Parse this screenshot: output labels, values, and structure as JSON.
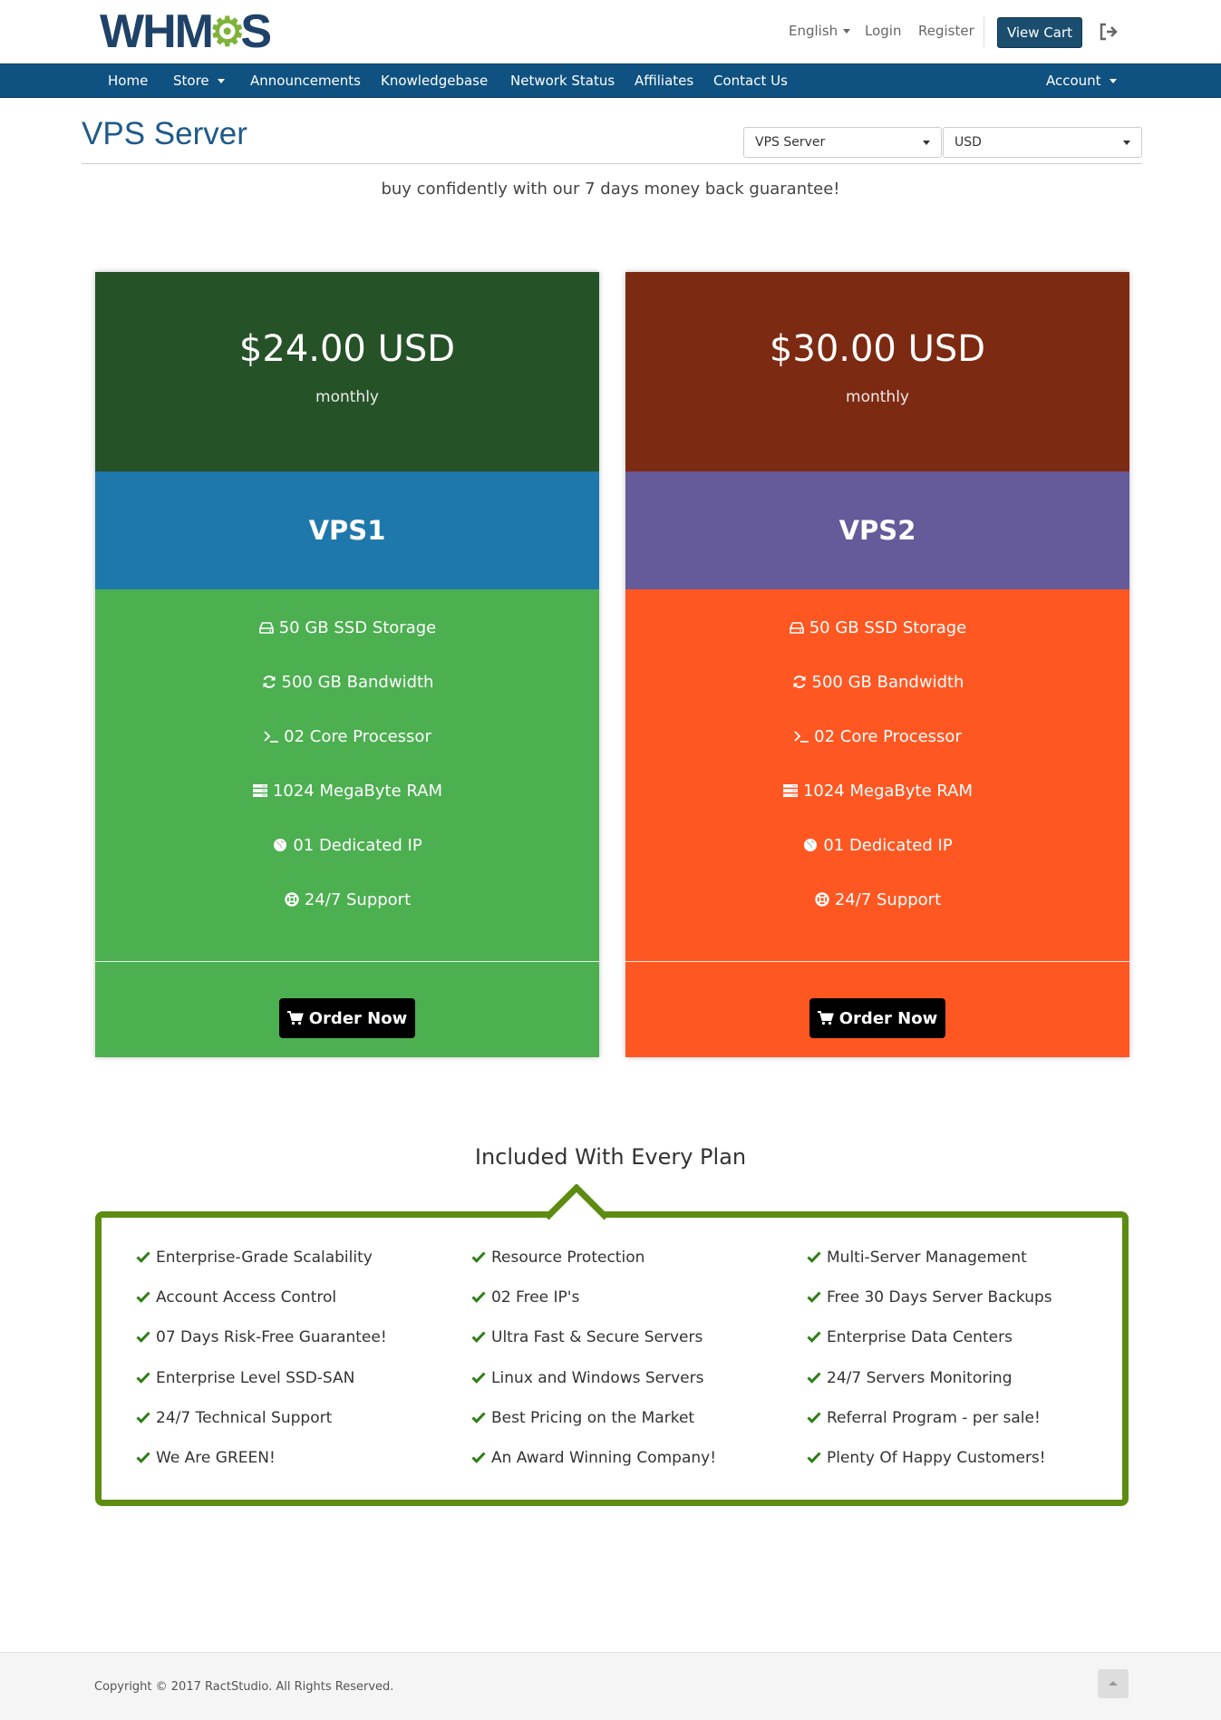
{
  "brand": {
    "logo_text_a": "WHM",
    "logo_text_b": "S"
  },
  "topbar": {
    "language": "English",
    "login": "Login",
    "register": "Register",
    "view_cart": "View Cart"
  },
  "nav": {
    "items": [
      "Home",
      "Store",
      "Announcements",
      "Knowledgebase",
      "Network Status",
      "Affiliates",
      "Contact Us"
    ],
    "account": "Account"
  },
  "page": {
    "title": "VPS Server",
    "product_group_select": "VPS Server",
    "currency_select": "USD",
    "tagline": "buy confidently with our 7 days money back guarantee!"
  },
  "plans": [
    {
      "price": "$24.00 USD",
      "cycle": "monthly",
      "name": "VPS1",
      "colors": {
        "head": "#265228",
        "name": "#1f78ab",
        "body": "#4caf50"
      },
      "features": [
        "50 GB SSD Storage",
        "500 GB Bandwidth",
        "02 Core Processor",
        "1024 MegaByte RAM",
        "01 Dedicated IP",
        "24/7 Support"
      ],
      "feature_icons": [
        "hdd-icon",
        "refresh-icon",
        "terminal-icon",
        "server-icon",
        "globe-icon",
        "support-icon"
      ],
      "order_label": "Order Now"
    },
    {
      "price": "$30.00 USD",
      "cycle": "monthly",
      "name": "VPS2",
      "colors": {
        "head": "#7d2a12",
        "name": "#655a9a",
        "body": "#ff5722"
      },
      "features": [
        "50 GB SSD Storage",
        "500 GB Bandwidth",
        "02 Core Processor",
        "1024 MegaByte RAM",
        "01 Dedicated IP",
        "24/7 Support"
      ],
      "feature_icons": [
        "hdd-icon",
        "refresh-icon",
        "terminal-icon",
        "server-icon",
        "globe-icon",
        "support-icon"
      ],
      "order_label": "Order Now"
    }
  ],
  "included": {
    "title": "Included With Every Plan",
    "columns": [
      [
        "Enterprise-Grade Scalability",
        "Account Access Control",
        "07 Days Risk-Free Guarantee!",
        "Enterprise Level SSD-SAN",
        "24/7 Technical Support",
        "We Are GREEN!"
      ],
      [
        "Resource Protection",
        "02 Free IP's",
        "Ultra Fast & Secure Servers",
        "Linux and Windows Servers",
        "Best Pricing on the Market",
        "An Award Winning Company!"
      ],
      [
        "Multi-Server Management",
        "Free 30 Days Server Backups",
        "Enterprise Data Centers",
        "24/7 Servers Monitoring",
        "Referral Program - per sale!",
        "Plenty Of Happy Customers!"
      ]
    ],
    "accent": "#5c8c12",
    "check_color": "#2e7d16"
  },
  "footer": {
    "copyright": "Copyright © 2017 RactStudio. All Rights Reserved."
  }
}
